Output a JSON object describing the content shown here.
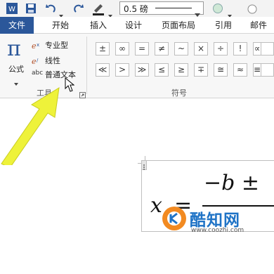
{
  "qat": {
    "word_icon": "word-app-icon",
    "line_weight": "0.5 磅"
  },
  "tabs": [
    "文件",
    "开始",
    "插入",
    "设计",
    "页面布局",
    "引用",
    "邮件"
  ],
  "tools_group": {
    "formula_label": "公式",
    "items": [
      "专业型",
      "线性",
      "普通文本"
    ],
    "abc_label": "abc",
    "group_label": "工具"
  },
  "symbols_group": {
    "row1": [
      "±",
      "∞",
      "=",
      "≠",
      "~",
      "×",
      "÷",
      "!",
      "∝"
    ],
    "row2": [
      "≪",
      ">",
      "≫",
      "≤",
      "≥",
      "∓",
      "≅",
      "≈",
      "≡"
    ],
    "group_label": "符号"
  },
  "equation": {
    "x": "x",
    "equals": "=",
    "numerator": "−b ±"
  },
  "watermark": {
    "brand": "酷知网",
    "url": "www.coozhi.com"
  },
  "colors": {
    "file_tab": "#2b579a",
    "arrow": "#eef23a",
    "logo_orange": "#f28a21",
    "logo_blue": "#1f73c6"
  }
}
